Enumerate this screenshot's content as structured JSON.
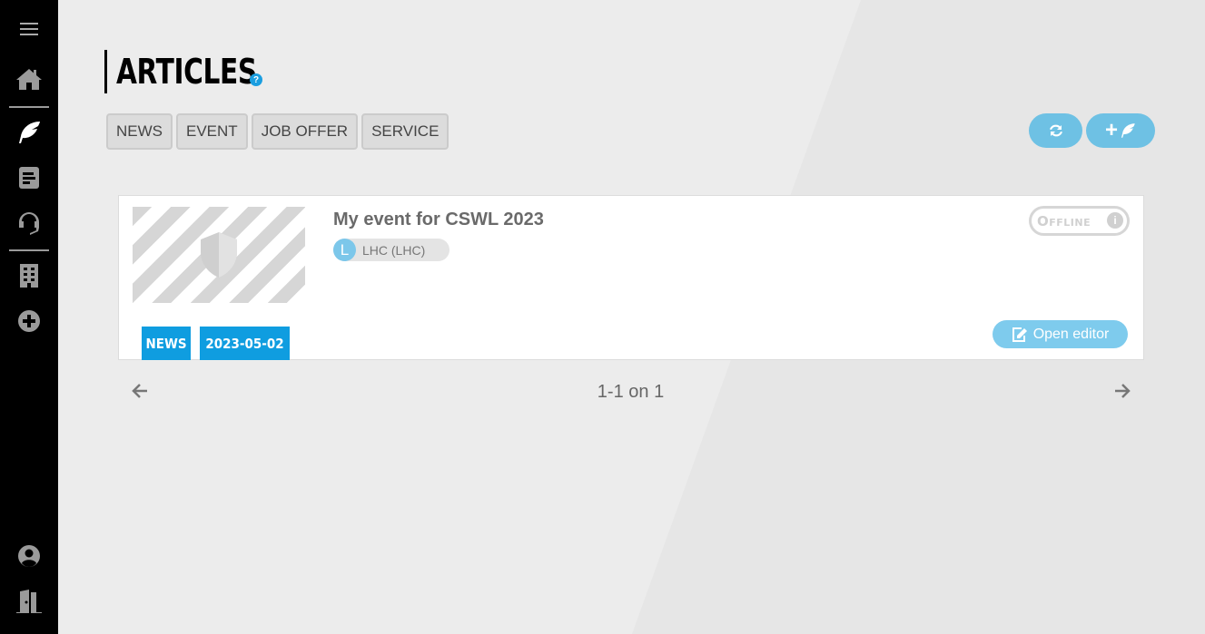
{
  "sidebar": {
    "items": [
      {
        "icon": "menu-icon"
      },
      {
        "icon": "home-icon"
      },
      {
        "icon": "feather-icon"
      },
      {
        "icon": "document-icon"
      },
      {
        "icon": "headset-icon"
      },
      {
        "icon": "building-icon"
      },
      {
        "icon": "plus-circle-icon"
      },
      {
        "icon": "user-circle-icon"
      },
      {
        "icon": "door-exit-icon"
      }
    ]
  },
  "header": {
    "title": "ARTICLES",
    "help_glyph": "?"
  },
  "filters": [
    "NEWS",
    "EVENT",
    "JOB OFFER",
    "SERVICE"
  ],
  "actions": {
    "refresh_icon": "refresh-icon",
    "add_icon": "add-feather-icon",
    "add_glyph": "+"
  },
  "articles": [
    {
      "title": "My event for CSWL 2023",
      "author_initial": "L",
      "author": "LHC (LHC)",
      "status": "Offline",
      "status_icon_glyph": "i",
      "category": "NEWS",
      "date": "2023-05-02",
      "open_editor_label": "Open editor"
    }
  ],
  "pagination": {
    "text": "1-1 on 1"
  },
  "colors": {
    "accent": "#0f9de0",
    "button": "#6ec1e4",
    "sidebar": "#000000"
  }
}
